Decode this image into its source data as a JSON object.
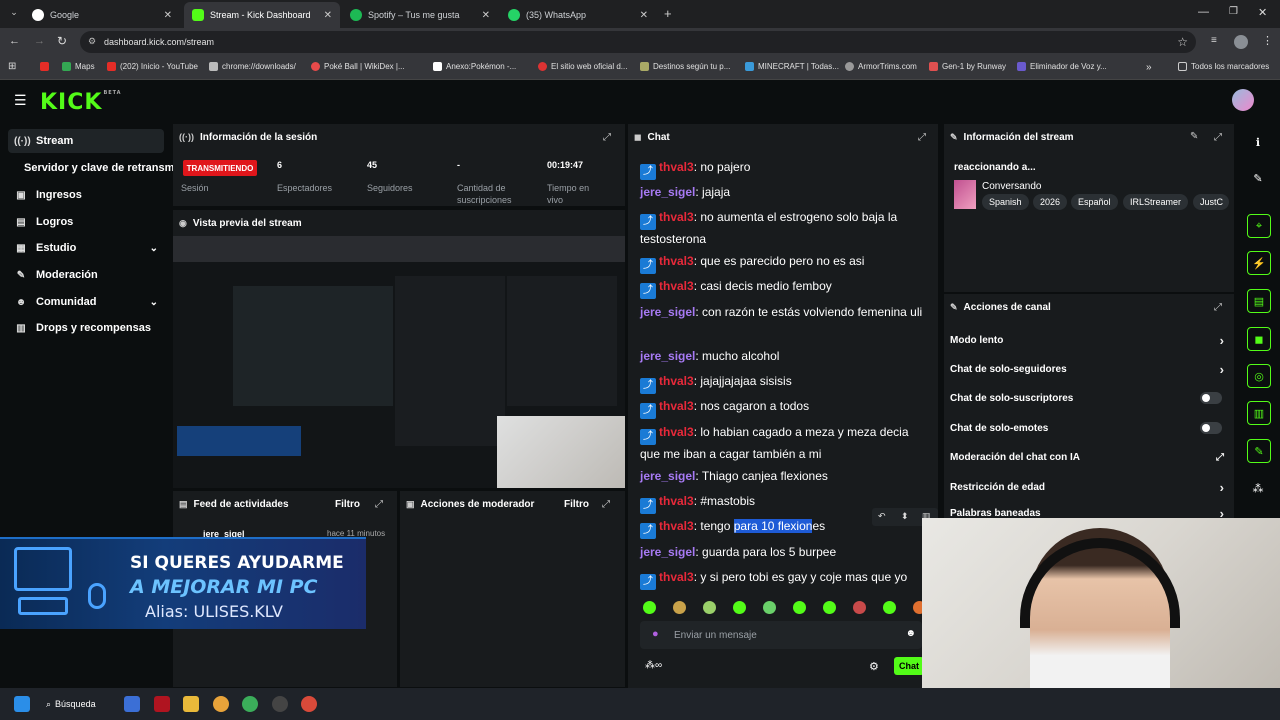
{
  "browser": {
    "tabs": [
      {
        "title": "Google",
        "color": "#4285f4"
      },
      {
        "title": "Stream - Kick Dashboard",
        "color": "#53fc18"
      },
      {
        "title": "Spotify – Tus me gusta",
        "color": "#1db954"
      },
      {
        "title": "(35) WhatsApp",
        "color": "#25d366"
      }
    ],
    "url": "dashboard.kick.com/stream",
    "bookmarks": [
      {
        "label": "",
        "color": "#e52d27"
      },
      {
        "label": "Maps",
        "color": "#34a853"
      },
      {
        "label": "(202) Inicio - YouTube",
        "color": "#e52d27"
      },
      {
        "label": "chrome://downloads/",
        "color": "#bbbbbb"
      },
      {
        "label": "Poké Ball | WikiDex |...",
        "color": "#e84a4a"
      },
      {
        "label": "Anexo:Pokémon -...",
        "color": "#ffffff"
      },
      {
        "label": "El sitio web oficial d...",
        "color": "#d33"
      },
      {
        "label": "Destinos según tu p...",
        "color": "#aa6"
      },
      {
        "label": "MINECRAFT | Todas...",
        "color": "#3a9ad9"
      },
      {
        "label": "ArmorTrims.com",
        "color": "#999"
      },
      {
        "label": "Gen-1 by Runway",
        "color": "#e05050"
      },
      {
        "label": "Eliminador de Voz y...",
        "color": "#6a5acd"
      }
    ],
    "all_bookmarks": "Todos los marcadores"
  },
  "kick": {
    "logo": "KICK",
    "logo_badge": "BETA",
    "nav": [
      {
        "label": "Stream",
        "icon": "broadcast-icon"
      },
      {
        "label": "Servidor y clave de retransmisión",
        "icon": ""
      },
      {
        "label": "Ingresos",
        "icon": "wallet-icon"
      },
      {
        "label": "Logros",
        "icon": "trophy-icon"
      },
      {
        "label": "Estudio",
        "icon": "studio-icon"
      },
      {
        "label": "Moderación",
        "icon": "wrench-icon"
      },
      {
        "label": "Comunidad",
        "icon": "people-icon"
      },
      {
        "label": "Drops y recompensas",
        "icon": "gift-icon"
      }
    ]
  },
  "session": {
    "title": "Información de la sesión",
    "status": "TRANSMITIENDO",
    "session_label": "Sesión",
    "stats": [
      {
        "value": "6",
        "label": "Espectadores"
      },
      {
        "value": "45",
        "label": "Seguidores"
      },
      {
        "value": "-",
        "label": "Cantidad de suscripciones"
      },
      {
        "value": "00:19:47",
        "label": "Tiempo en vivo"
      }
    ]
  },
  "preview": {
    "title": "Vista previa del stream"
  },
  "feed": {
    "title": "Feed de actividades",
    "filter": "Filtro",
    "item_user": "jere_sigel",
    "item_time": "hace 11 minutos"
  },
  "modactions": {
    "title": "Acciones de moderador",
    "filter": "Filtro"
  },
  "chat": {
    "title": "Chat",
    "messages": [
      {
        "user": "thval3",
        "text": ": no pajero",
        "badge": true,
        "color": "red"
      },
      {
        "user": "jere_sigel",
        "text": ": jajaja",
        "badge": false,
        "color": "purple"
      },
      {
        "user": "thval3",
        "text": ": no aumenta el estrogeno solo baja la testosterona",
        "badge": true,
        "color": "red"
      },
      {
        "user": "thval3",
        "text": ": que es parecido pero no es asi",
        "badge": true,
        "color": "red"
      },
      {
        "user": "thval3",
        "text": ": casi decis medio femboy",
        "badge": true,
        "color": "red"
      },
      {
        "user": "jere_sigel",
        "text": ": con razón te estás volviendo femenina uli",
        "badge": false,
        "color": "purple"
      },
      {
        "user": "jere_sigel",
        "text": ": mucho alcohol",
        "badge": false,
        "color": "purple"
      },
      {
        "user": "thval3",
        "text": ": jajajjajajaa sisisis",
        "badge": true,
        "color": "red"
      },
      {
        "user": "thval3",
        "text": ": nos cagaron a todos",
        "badge": true,
        "color": "red"
      },
      {
        "user": "thval3",
        "text": ": lo habian cagado a meza y meza decia que me iban a cagar también a mi",
        "badge": true,
        "color": "red"
      },
      {
        "user": "jere_sigel",
        "text": ": Thiago canjea flexiones",
        "badge": false,
        "color": "purple"
      },
      {
        "user": "thval3",
        "text": ": #mastobis",
        "badge": true,
        "color": "red"
      }
    ],
    "highlight_msg": {
      "user": "thval3",
      "pre": ": tengo ",
      "sel": "para 10 flexion",
      "post": "es"
    },
    "msg_after1": {
      "user": "jere_sigel",
      "text": ": guarda para los 5 burpee"
    },
    "msg_after2": {
      "user": "thval3",
      "text": ": y si pero tobi es gay y coje mas que yo"
    },
    "placeholder": "Enviar un mensaje",
    "send_label": "Chat"
  },
  "streaminfo": {
    "title": "Información del stream",
    "reacting": "reaccionando a...",
    "category": "Conversando",
    "tags": [
      "Spanish",
      "2026",
      "Español",
      "IRLStreamer",
      "JustC"
    ]
  },
  "channel_actions": {
    "title": "Acciones de canal",
    "items": [
      {
        "label": "Modo lento",
        "kind": "chevron"
      },
      {
        "label": "Chat de solo-seguidores",
        "kind": "chevron"
      },
      {
        "label": "Chat de solo-suscriptores",
        "kind": "toggle"
      },
      {
        "label": "Chat de solo-emotes",
        "kind": "toggle"
      },
      {
        "label": "Moderación del chat con IA",
        "kind": "external"
      },
      {
        "label": "Restricción de edad",
        "kind": "chevron"
      },
      {
        "label": "Palabras baneadas",
        "kind": "chevron"
      }
    ]
  },
  "banner": {
    "line1": "SI QUERES AYUDARME",
    "line2": "A MEJORAR MI PC",
    "line3": "Alias: ULISES.KLV"
  },
  "taskbar": {
    "search": "Búsqueda"
  }
}
